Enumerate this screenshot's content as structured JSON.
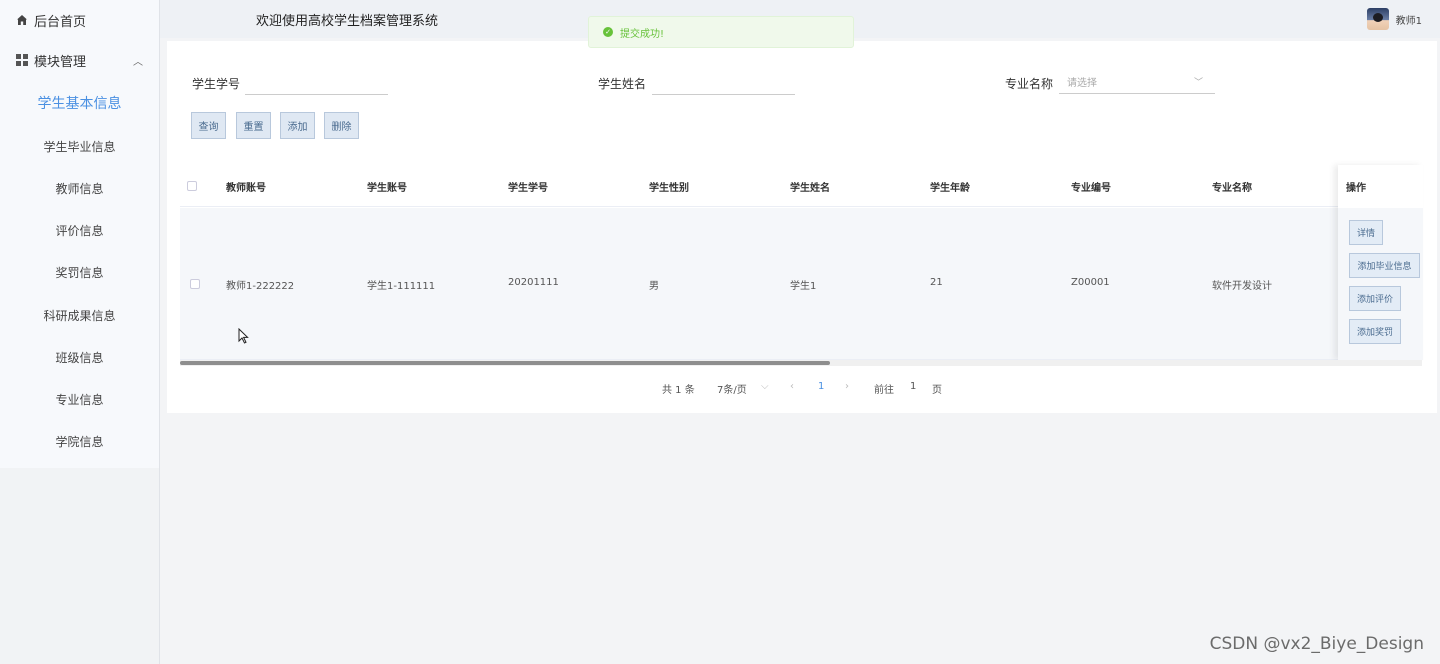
{
  "sidebar": {
    "home_label": "后台首页",
    "module_label": "模块管理",
    "items": [
      {
        "label": "学生基本信息",
        "active": true
      },
      {
        "label": "学生毕业信息"
      },
      {
        "label": "教师信息"
      },
      {
        "label": "评价信息"
      },
      {
        "label": "奖罚信息"
      },
      {
        "label": "科研成果信息"
      },
      {
        "label": "班级信息"
      },
      {
        "label": "专业信息"
      },
      {
        "label": "学院信息"
      }
    ]
  },
  "header": {
    "welcome": "欢迎使用高校学生档案管理系统",
    "user_name": "教师1"
  },
  "toast": {
    "message": "提交成功!"
  },
  "search": {
    "student_no_label": "学生学号",
    "student_no_value": "",
    "student_name_label": "学生姓名",
    "student_name_value": "",
    "major_label": "专业名称",
    "major_placeholder": "请选择"
  },
  "actions": {
    "query": "查询",
    "reset": "重置",
    "add": "添加",
    "delete": "删除"
  },
  "table": {
    "columns": [
      "教师账号",
      "学生账号",
      "学生学号",
      "学生性别",
      "学生姓名",
      "学生年龄",
      "专业编号",
      "专业名称",
      "操作"
    ],
    "rows": [
      {
        "teacher_account": "教师1-222222",
        "student_account": "学生1-111111",
        "student_no": "20201111",
        "gender": "男",
        "name": "学生1",
        "age": "21",
        "major_no": "Z00001",
        "major_name": "软件开发设计",
        "ops": [
          "详情",
          "添加毕业信息",
          "添加评价",
          "添加奖罚"
        ]
      }
    ]
  },
  "pagination": {
    "total": "共 1 条",
    "page_size": "7条/页",
    "current_page": "1",
    "goto_label": "前往",
    "goto_value": "1",
    "page_unit": "页"
  },
  "watermark": "CSDN @vx2_Biye_Design"
}
